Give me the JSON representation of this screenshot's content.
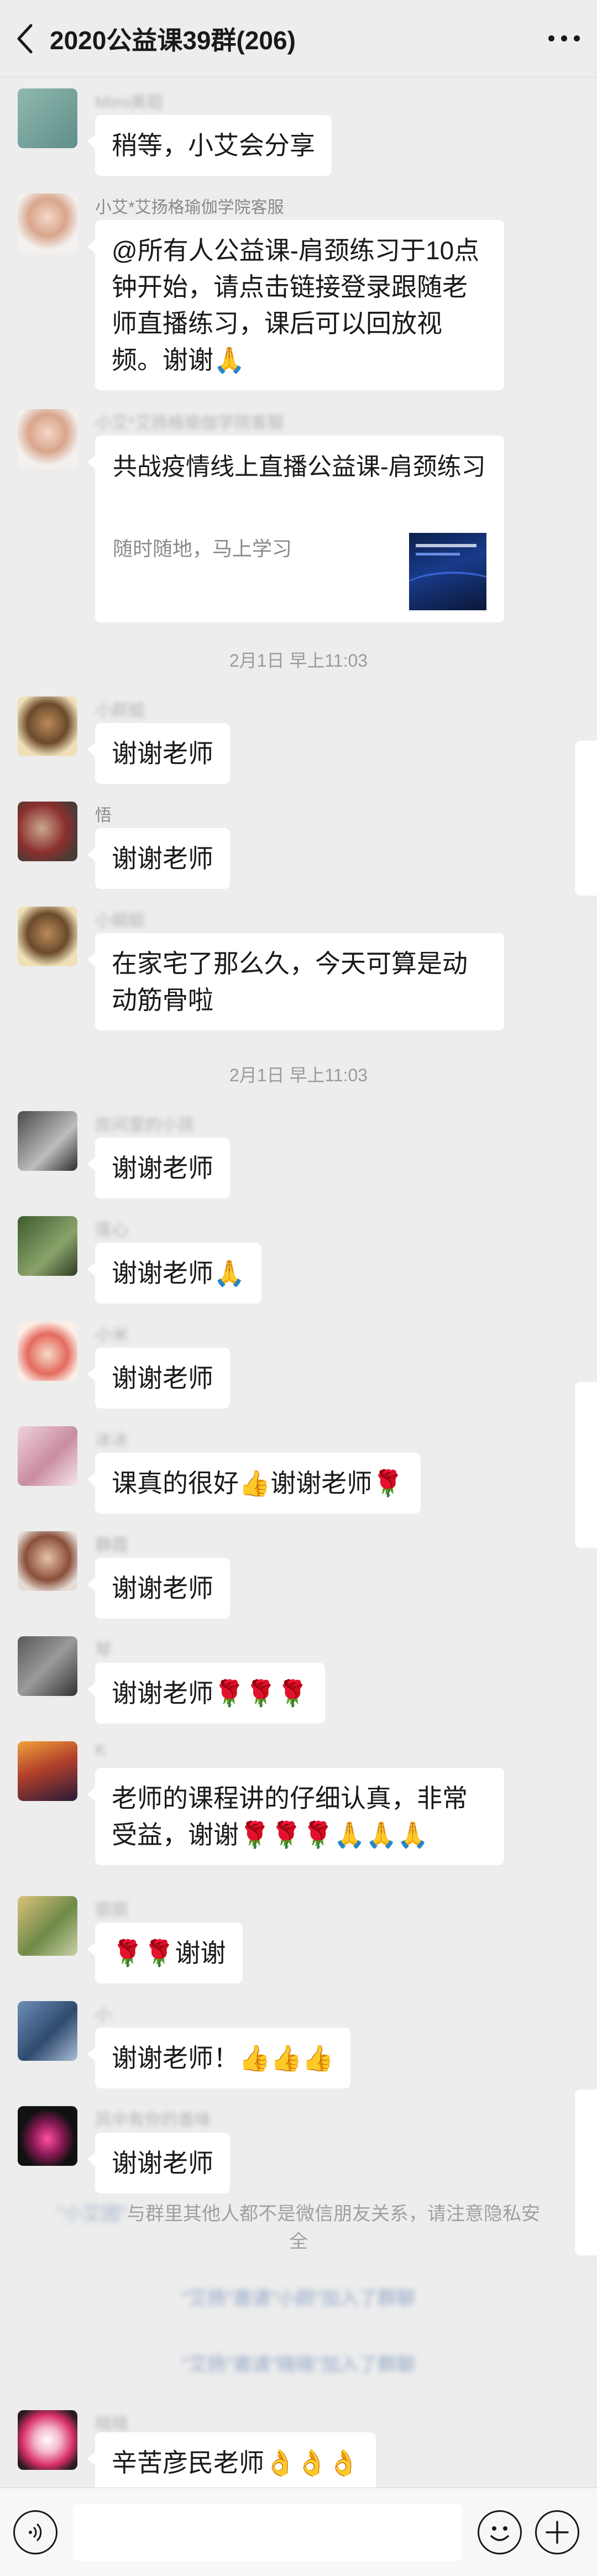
{
  "header": {
    "title": "2020公益课39群(206)",
    "back_icon": "chevron-left-icon",
    "more_icon": "more-dots-icon"
  },
  "messages": [
    {
      "name": "Mimi美姐",
      "text": "稍等，小艾会分享"
    },
    {
      "name": "小艾*艾扬格瑜伽学院客服",
      "text": "@所有人公益课-肩颈练习于10点钟开始，请点击链接登录跟随老师直播练习，课后可以回放视频。谢谢🙏"
    },
    {
      "name": "小艾*艾扬格瑜伽学院客服",
      "card": {
        "title": "共战疫情线上直播公益课-肩颈练习",
        "desc": "随时随地，马上学习"
      }
    },
    {
      "name": "小颜姐",
      "text": "谢谢老师"
    },
    {
      "name": "悟",
      "text": "谢谢老师"
    },
    {
      "name": "小娟姐",
      "text": "在家宅了那么久，今天可算是动动筋骨啦"
    },
    {
      "name": "房间里的小孩",
      "text": "谢谢老师"
    },
    {
      "name": "莲心",
      "text": "谢谢老师🙏"
    },
    {
      "name": "小米",
      "text": "谢谢老师"
    },
    {
      "name": "冰冰",
      "text": "课真的很好👍谢谢老师🌹"
    },
    {
      "name": "静霞",
      "text": "谢谢老师"
    },
    {
      "name": "琴",
      "text": "谢谢老师🌹🌹🌹"
    },
    {
      "name": "K",
      "text": "老师的课程讲的仔细认真，非常受益，谢谢🌹🌹🌹🙏🙏🙏"
    },
    {
      "name": "丽丽",
      "text": "🌹🌹谢谢"
    },
    {
      "name": "小",
      "text": "谢谢老师！👍👍👍"
    },
    {
      "name": "风中有你的香味",
      "text": "谢谢老师"
    },
    {
      "name": "晓晓",
      "text": "辛苦彦民老师👌👌👌"
    }
  ],
  "timestamps": [
    "2月1日 早上11:03",
    "2月1日 早上11:03"
  ],
  "notice": {
    "blur_part": "\"小艾团\"",
    "text": "与群里其他人都不是微信朋友关系，请注意隐私安全"
  },
  "joins": [
    "\"艾扬\"邀请\"小颜\"加入了群聊",
    "\"艾扬\"邀请\"晓晓\"加入了群聊"
  ],
  "inputbar": {
    "voice_icon": "voice-icon",
    "emoji_icon": "emoji-icon",
    "plus_icon": "plus-icon",
    "input_value": "",
    "input_placeholder": ""
  },
  "colors": {
    "background": "#ededed",
    "bubble": "#ffffff",
    "text": "#191919",
    "meta": "#9b9b9b"
  }
}
